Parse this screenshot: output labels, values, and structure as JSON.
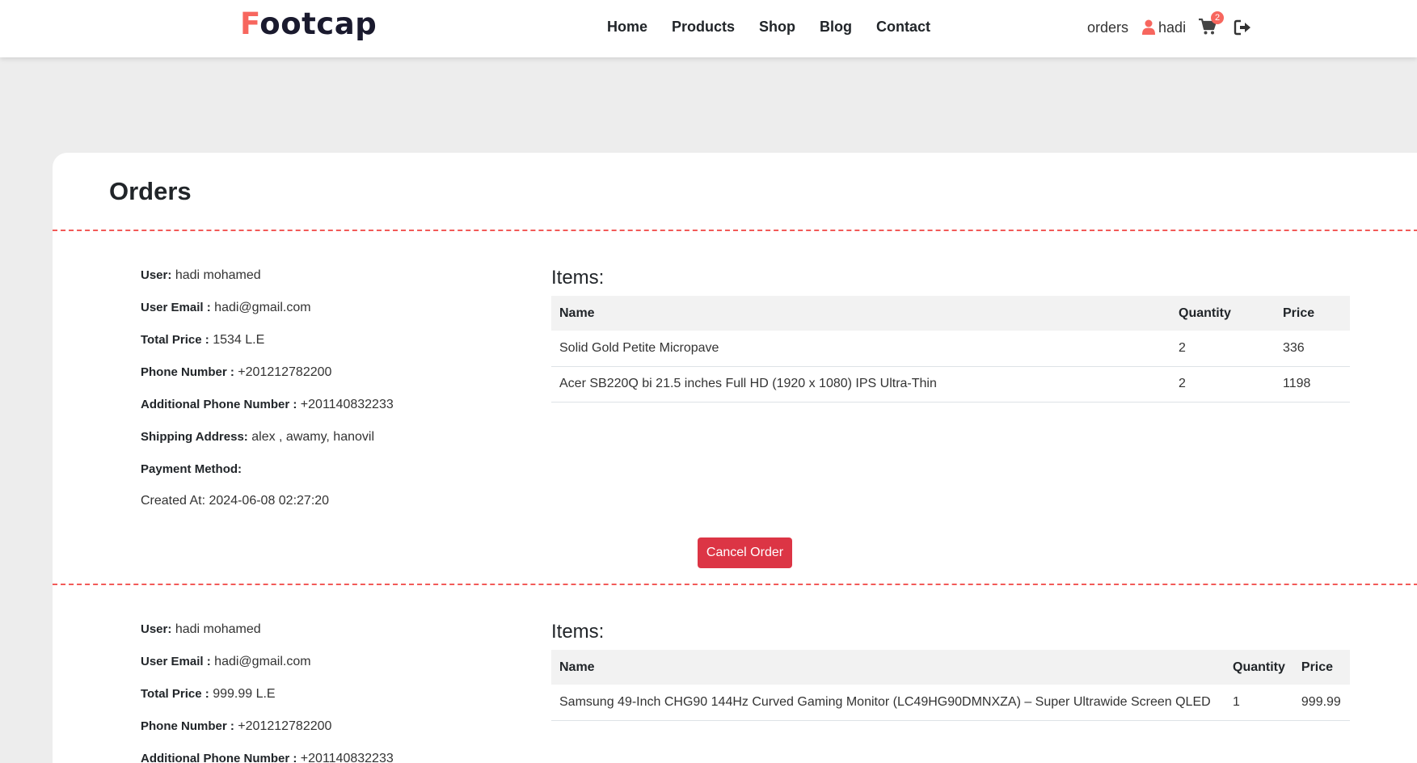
{
  "header": {
    "logo_first": "F",
    "logo_rest": "ootcap",
    "nav": [
      "Home",
      "Products",
      "Shop",
      "Blog",
      "Contact"
    ],
    "orders_link": "orders",
    "user_name": "hadi",
    "cart_count": "2",
    "icons": [
      "user-icon",
      "cart-icon",
      "logout-icon"
    ]
  },
  "page": {
    "title": "Orders"
  },
  "labels": {
    "user": "User:",
    "email": "User Email :",
    "total": "Total Price :",
    "phone": "Phone Number :",
    "phone2": "Additional Phone Number :",
    "address": "Shipping Address:",
    "payment": "Payment Method:",
    "items_title": "Items:",
    "col_name": "Name",
    "col_qty": "Quantity",
    "col_price": "Price",
    "cancel": "Cancel Order"
  },
  "orders": [
    {
      "user": "hadi mohamed",
      "email": "hadi@gmail.com",
      "total": "1534 L.E",
      "phone": "+201212782200",
      "phone2": "+201140832233",
      "address": "alex , awamy, hanovil",
      "payment": "",
      "created": "Created At: 2024-06-08 02:27:20",
      "items": [
        {
          "name": "Solid Gold Petite Micropave",
          "qty": "2",
          "price": "336"
        },
        {
          "name": "Acer SB220Q bi 21.5 inches Full HD (1920 x 1080) IPS Ultra-Thin",
          "qty": "2",
          "price": "1198"
        }
      ]
    },
    {
      "user": "hadi mohamed",
      "email": "hadi@gmail.com",
      "total": "999.99 L.E",
      "phone": "+201212782200",
      "phone2": "+201140832233",
      "items": [
        {
          "name": "Samsung 49-Inch CHG90 144Hz Curved Gaming Monitor (LC49HG90DMNXZA) – Super Ultrawide Screen QLED",
          "qty": "1",
          "price": "999.99"
        }
      ]
    }
  ],
  "colors": {
    "accent": "#f7665e",
    "danger": "#dc3545",
    "divider": "#f25a58",
    "background": "#ededed"
  }
}
